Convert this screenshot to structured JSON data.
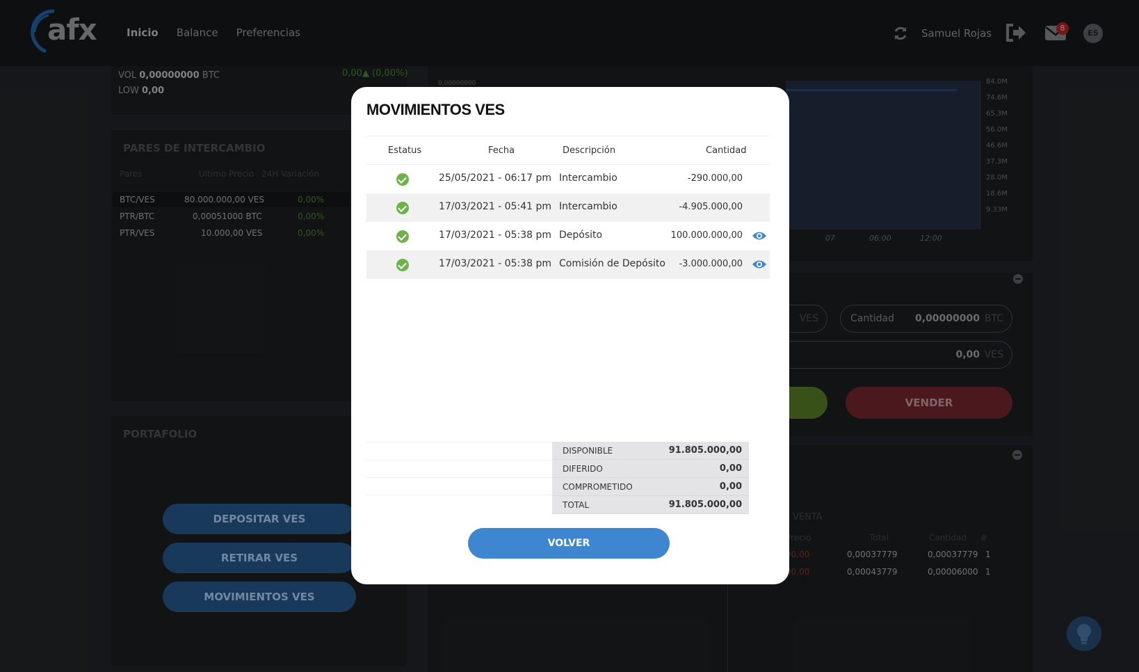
{
  "header": {
    "logo_text": "afx",
    "nav": [
      "Inicio",
      "Balance",
      "Preferencias"
    ],
    "user_name": "Samuel Rojas",
    "mail_count": "8",
    "lang": "ES"
  },
  "market": {
    "vol_label": "VOL",
    "vol_value": "0,00000000",
    "vol_unit": "BTC",
    "low_label": "LOW",
    "low_value": "0,00",
    "change": "0,00▲ (0,00%)"
  },
  "pairs": {
    "title": "PARES DE INTERCAMBIO",
    "headers": [
      "Pares",
      "Ultimo Precio",
      "24H Variación"
    ],
    "rows": [
      {
        "pair": "BTC/VES",
        "price": "80.000.000,00 VES",
        "var": "0,00%"
      },
      {
        "pair": "PTR/BTC",
        "price": "0,00051000 BTC",
        "var": "0,00%"
      },
      {
        "pair": "PTR/VES",
        "price": "10.000,00 VES",
        "var": "0,00%"
      }
    ]
  },
  "portfolio": {
    "title": "PORTAFOLIO",
    "buttons": [
      "DEPOSITAR VES",
      "RETIRAR VES",
      "MOVIMIENTOS VES"
    ]
  },
  "chart": {
    "y_ticks": [
      "84.0M",
      "74.6M",
      "65.3M",
      "56.0M",
      "46.6M",
      "37.3M",
      "28.0M",
      "18.6M",
      "9.33M"
    ],
    "x_ticks": [
      "07",
      "06:00",
      "12:00"
    ],
    "top_value": "0,00000000"
  },
  "trade": {
    "cantidad_label": "Cantidad",
    "cantidad_value": "0,00000000",
    "cantidad_unit": "BTC",
    "price_unit": "VES",
    "total_value": "0,00",
    "total_unit": "VES",
    "sell_label": "VENDER"
  },
  "orders": {
    "venta_label": "VENTA",
    "headers": [
      "Precio",
      "Total",
      "Cantidad",
      "#"
    ],
    "rows": [
      {
        "total": "0,00037779",
        "cantidad": "0,00037779",
        "n": "1"
      },
      {
        "total": "0,00043779",
        "cantidad": "0,00006000",
        "n": "1"
      }
    ]
  },
  "modal": {
    "title": "MOVIMIENTOS VES",
    "headers": {
      "status": "Estatus",
      "date": "Fecha",
      "desc": "Descripción",
      "amount": "Cantidad"
    },
    "rows": [
      {
        "date": "25/05/2021 - 06:17 pm",
        "desc": "Intercambio",
        "amount": "-290.000,00",
        "eye": false
      },
      {
        "date": "17/03/2021 - 05:41 pm",
        "desc": "Intercambio",
        "amount": "-4.905.000,00",
        "eye": false
      },
      {
        "date": "17/03/2021 - 05:38 pm",
        "desc": "Depósito",
        "amount": "100.000.000,00",
        "eye": true
      },
      {
        "date": "17/03/2021 - 05:38 pm",
        "desc": "Comisión de Depósito",
        "amount": "-3.000.000,00",
        "eye": true
      }
    ],
    "summary": [
      {
        "label": "DISPONIBLE",
        "value": "91.805.000,00"
      },
      {
        "label": "DIFERIDO",
        "value": "0,00"
      },
      {
        "label": "COMPROMETIDO",
        "value": "0,00"
      },
      {
        "label": "TOTAL",
        "value": "91.805.000,00"
      }
    ],
    "back_label": "VOLVER"
  },
  "colors": {
    "accent": "#3f86d0",
    "success": "#6fb24a",
    "modal_bg": "#ffffff",
    "page_bg": "#1b1d20"
  }
}
